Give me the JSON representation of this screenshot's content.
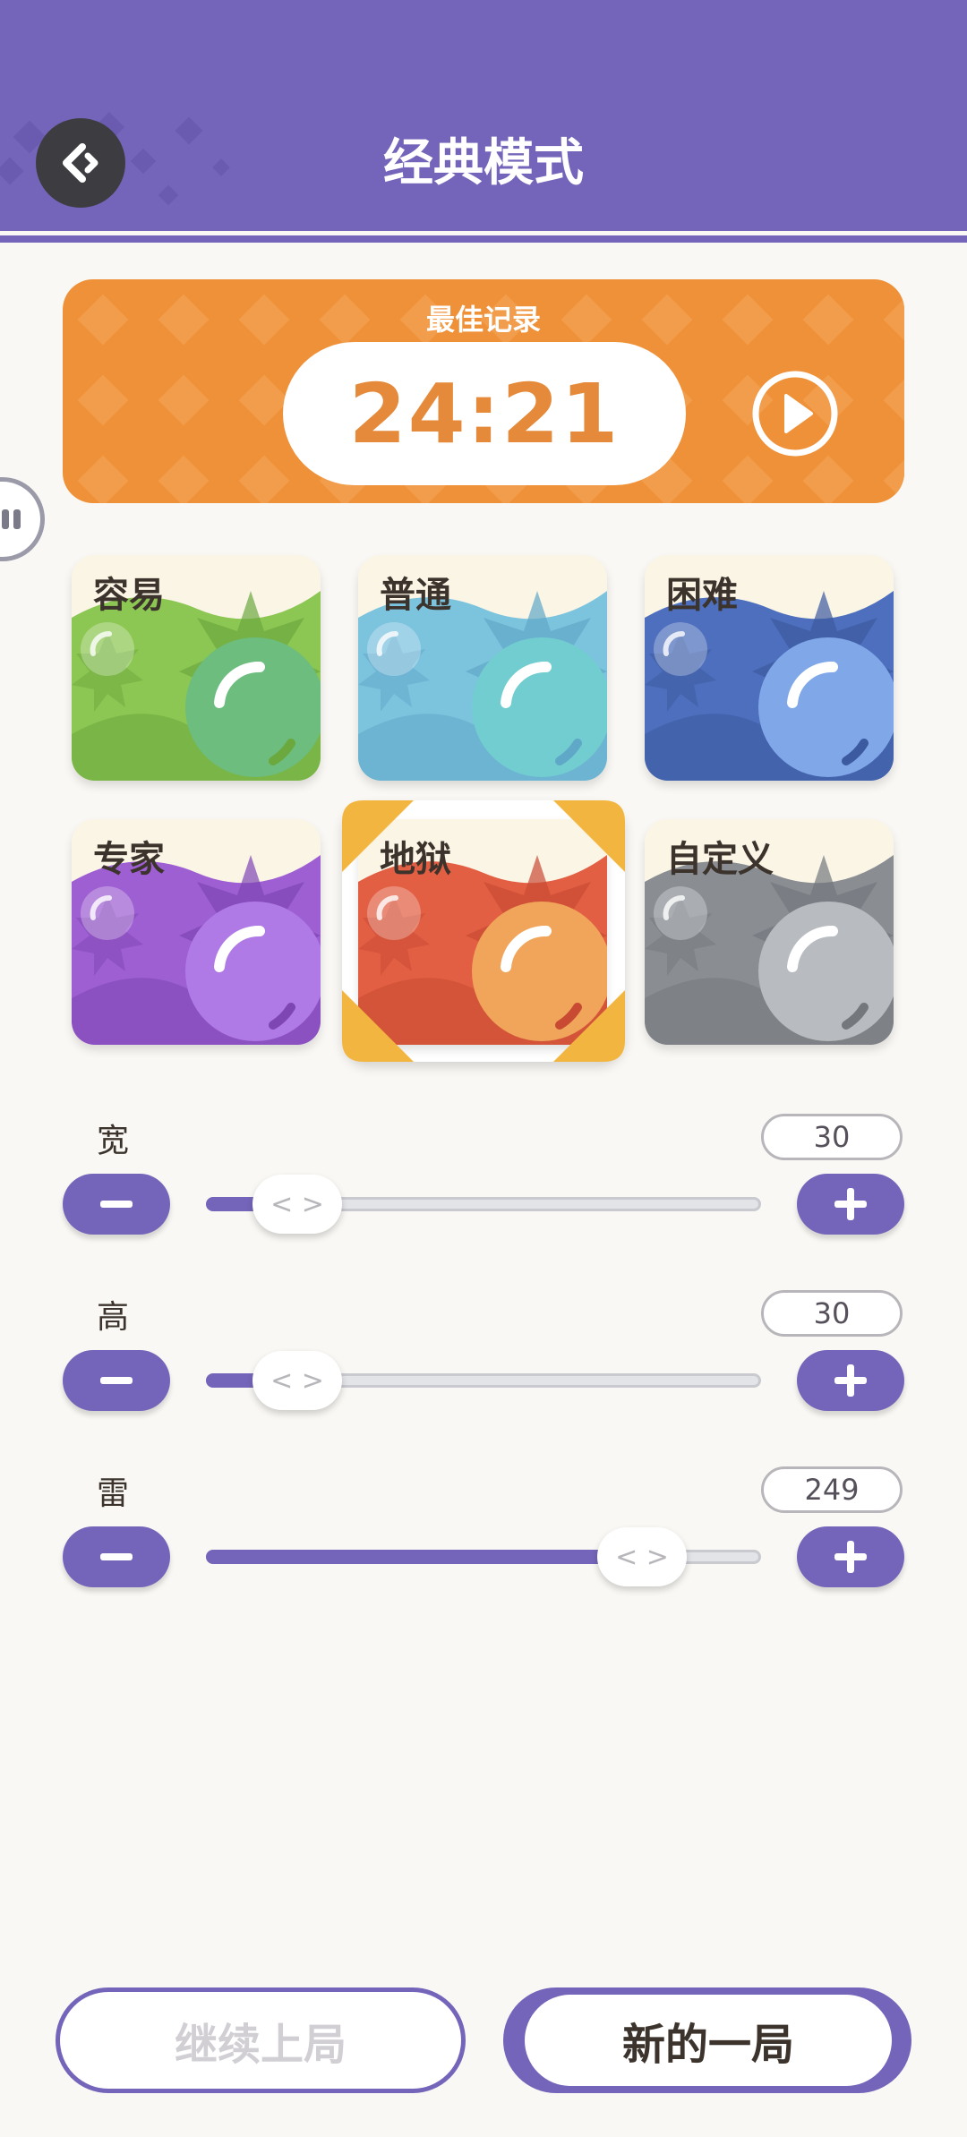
{
  "header": {
    "title": "经典模式",
    "back_icon": "diamond-back-icon",
    "color": "#7565ba"
  },
  "best_record": {
    "label": "最佳记录",
    "time": "24:21",
    "replay_icon": "play-circle-icon",
    "color": "#ef9138"
  },
  "difficulties": [
    {
      "label": "容易",
      "base": "#8cc653",
      "dark": "#6ba83e",
      "ball": "#6cbd7e",
      "selected": false
    },
    {
      "label": "普通",
      "base": "#7cc3de",
      "dark": "#5fa8c7",
      "ball": "#72cdd0",
      "selected": false
    },
    {
      "label": "困难",
      "base": "#4d6fbd",
      "dark": "#3c5aa0",
      "ball": "#80a8e8",
      "selected": false
    },
    {
      "label": "专家",
      "base": "#9e5fd3",
      "dark": "#7e46b3",
      "ball": "#b07ae6",
      "selected": false
    },
    {
      "label": "地狱",
      "base": "#e25f43",
      "dark": "#c94a33",
      "ball": "#f0a55a",
      "selected": true
    },
    {
      "label": "自定义",
      "base": "#8a8e93",
      "dark": "#74787d",
      "ball": "#b8bcc1",
      "selected": false
    }
  ],
  "sliders": [
    {
      "label": "宽",
      "value": "30",
      "fraction": 0.16
    },
    {
      "label": "高",
      "value": "30",
      "fraction": 0.16
    },
    {
      "label": "雷",
      "value": "249",
      "fraction": 0.78
    }
  ],
  "slider_thumb_glyph": "< >",
  "buttons": {
    "continue": "继续上局",
    "new_game": "新的一局"
  }
}
